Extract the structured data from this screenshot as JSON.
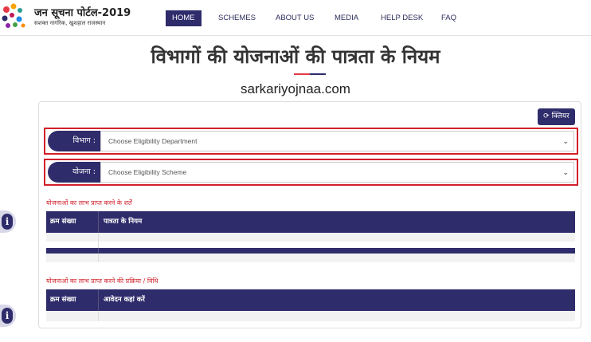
{
  "header": {
    "brand_title": "जन सूचना पोर्टल-2019",
    "brand_subtitle": "सशक्त नागरिक, खुशहाल राजस्थान",
    "nav": [
      {
        "label": "HOME",
        "active": true
      },
      {
        "label": "SCHEMES",
        "active": false
      },
      {
        "label": "ABOUT US",
        "active": false
      },
      {
        "label": "MEDIA",
        "active": false
      },
      {
        "label": "HELP DESK",
        "active": false
      },
      {
        "label": "FAQ",
        "active": false
      }
    ]
  },
  "page": {
    "title": "विभागों की योजनाओं की पात्रता के नियम",
    "watermark": "sarkariyojnaa.com"
  },
  "form": {
    "clear_label": "क्लियर",
    "department": {
      "label": "विभाग :",
      "value": "Choose Eligibility Department"
    },
    "scheme": {
      "label": "योजना :",
      "value": "Choose Eligibility Scheme"
    }
  },
  "conditions": {
    "title": "योजनाओं का लाभ प्राप्त करने के शर्तें",
    "headers": [
      "क्रम संख्या",
      "पात्रता के नियम"
    ]
  },
  "procedure": {
    "title": "योजनाओं का लाभ प्राप्त करने की प्रक्रिया / विधि",
    "headers": [
      "क्रम संख्या",
      "आवेदन कहां करें"
    ]
  },
  "colors": {
    "primary": "#2e2c6b",
    "accent": "#d21f2a"
  },
  "icons": {
    "refresh": "refresh-icon",
    "info": "info-icon",
    "chevron": "chevron-down-icon"
  }
}
